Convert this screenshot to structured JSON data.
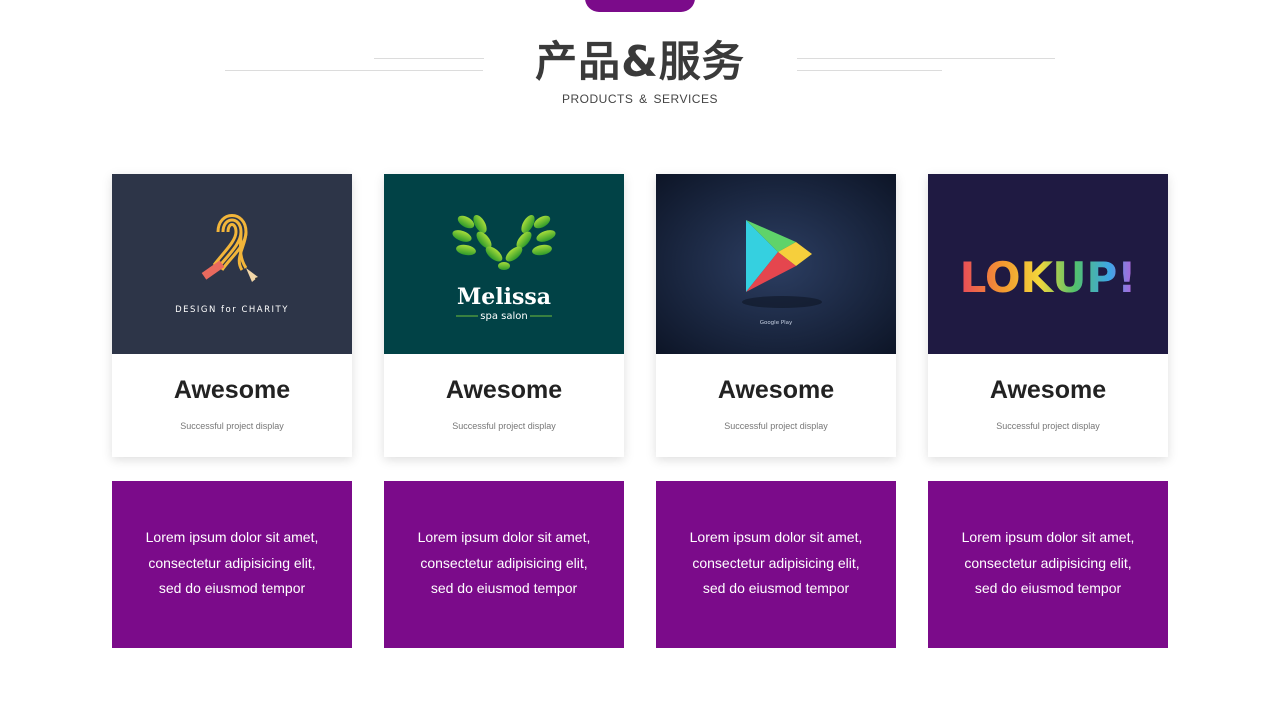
{
  "header": {
    "title": "产品&服务",
    "subtitle": "PRODUCTS & SERVICES"
  },
  "colors": {
    "accent": "#7b0b8a",
    "charity_bg": "#2d3548",
    "melissa_bg": "#014246",
    "play_bg": "#1d2a44",
    "lokup_bg": "#1f1a42"
  },
  "cards": [
    {
      "title": "Awesome",
      "subtitle": "Successful project display",
      "logo_text": "DESIGN for CHARITY",
      "icon": "ribbon-pencil-icon",
      "description": [
        "Lorem ipsum dolor sit amet,",
        "consectetur adipisicing elit,",
        "sed do eiusmod tempor"
      ]
    },
    {
      "title": "Awesome",
      "subtitle": "Successful project display",
      "logo_text": "Melissa",
      "logo_sub": "spa salon",
      "icon": "leaf-m-icon",
      "description": [
        "Lorem ipsum dolor sit amet,",
        "consectetur adipisicing elit,",
        "sed do eiusmod tempor"
      ]
    },
    {
      "title": "Awesome",
      "subtitle": "Successful project display",
      "logo_text": "Google Play",
      "icon": "play-triangle-icon",
      "description": [
        "Lorem ipsum dolor sit amet,",
        "consectetur adipisicing elit,",
        "sed do eiusmod tempor"
      ]
    },
    {
      "title": "Awesome",
      "subtitle": "Successful project display",
      "logo_text": "LOKUP!",
      "icon": "lokup-logo-icon",
      "description": [
        "Lorem ipsum dolor sit amet,",
        "consectetur adipisicing elit,",
        "sed do eiusmod tempor"
      ]
    }
  ]
}
